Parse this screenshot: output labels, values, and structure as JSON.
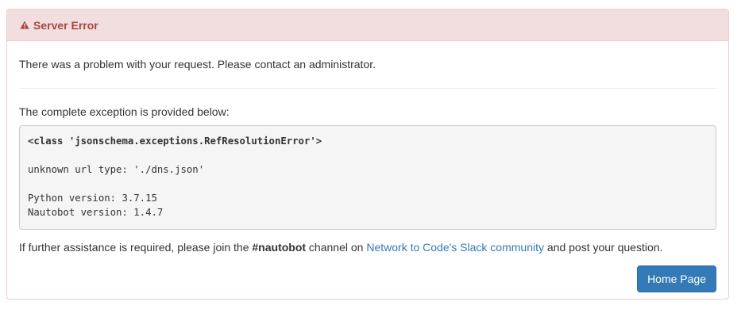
{
  "panel": {
    "title": "Server Error",
    "icon": "warning-icon",
    "heading_color": "#a94442"
  },
  "message": "There was a problem with your request. Please contact an administrator.",
  "exception_intro": "The complete exception is provided below:",
  "exception": {
    "class_line": "<class 'jsonschema.exceptions.RefResolutionError'>",
    "error_line": "unknown url type: './dns.json'",
    "python_version_line": "Python version: 3.7.15",
    "nautobot_version_line": "Nautobot version: 1.4.7"
  },
  "assistance": {
    "prefix": "If further assistance is required, please join the ",
    "channel": "#nautobot",
    "middle": " channel on ",
    "link_text": "Network to Code's Slack community",
    "suffix": " and post your question."
  },
  "home_button_label": "Home Page",
  "colors": {
    "accent": "#337ab7",
    "danger_bg": "#f2dede",
    "danger_border": "#ebccd1"
  }
}
